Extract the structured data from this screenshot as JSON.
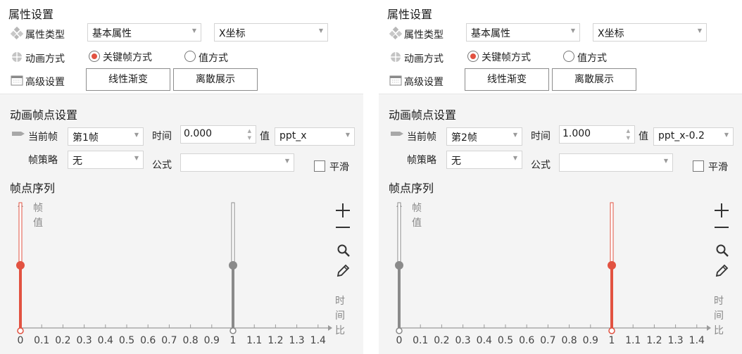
{
  "colors": {
    "accent": "#e25241",
    "gray_handle": "#8a8a8a",
    "axis": "#9a9a9a"
  },
  "panels": [
    {
      "property_settings": {
        "title": "属性设置",
        "property_type_label": "属性类型",
        "property_type_value": "基本属性",
        "property_sub_value": "X坐标",
        "animation_mode_label": "动画方式",
        "radio_keyframe": "关键帧方式",
        "radio_value": "值方式",
        "radio_selected": "keyframe",
        "advanced_label": "高级设置",
        "btn_linear": "线性渐变",
        "btn_discrete": "离散展示"
      },
      "frame_settings": {
        "title": "动画帧点设置",
        "current_frame_label": "当前帧",
        "current_frame_value": "第1帧",
        "time_label": "时间",
        "time_value": "0.000",
        "value_label": "值",
        "value_value": "ppt_x",
        "strategy_label": "帧策略",
        "strategy_value": "无",
        "formula_label": "公式",
        "formula_value": "",
        "smooth_label": "平滑"
      },
      "sequence": {
        "title": "帧点序列",
        "y_axis_label_1": "帧",
        "y_axis_label_2": "值",
        "x_axis_label_1": "时",
        "x_axis_label_2": "间",
        "x_axis_label_3": "比",
        "x_ticks": [
          "0",
          "0.1",
          "0.2",
          "0.3",
          "0.4",
          "0.5",
          "0.6",
          "0.7",
          "0.8",
          "0.9",
          "1",
          "1.1",
          "1.2",
          "1.3",
          "1.4"
        ],
        "x_range": [
          0,
          1.4
        ],
        "keyframes": [
          {
            "t": 0,
            "level": 0.5,
            "selected": true
          },
          {
            "t": 1,
            "level": 0.5,
            "selected": false
          }
        ]
      }
    },
    {
      "property_settings": {
        "title": "属性设置",
        "property_type_label": "属性类型",
        "property_type_value": "基本属性",
        "property_sub_value": "X坐标",
        "animation_mode_label": "动画方式",
        "radio_keyframe": "关键帧方式",
        "radio_value": "值方式",
        "radio_selected": "keyframe",
        "advanced_label": "高级设置",
        "btn_linear": "线性渐变",
        "btn_discrete": "离散展示"
      },
      "frame_settings": {
        "title": "动画帧点设置",
        "current_frame_label": "当前帧",
        "current_frame_value": "第2帧",
        "time_label": "时间",
        "time_value": "1.000",
        "value_label": "值",
        "value_value": "ppt_x-0.2",
        "strategy_label": "帧策略",
        "strategy_value": "无",
        "formula_label": "公式",
        "formula_value": "",
        "smooth_label": "平滑"
      },
      "sequence": {
        "title": "帧点序列",
        "y_axis_label_1": "帧",
        "y_axis_label_2": "值",
        "x_axis_label_1": "时",
        "x_axis_label_2": "间",
        "x_axis_label_3": "比",
        "x_ticks": [
          "0",
          "0.1",
          "0.2",
          "0.3",
          "0.4",
          "0.5",
          "0.6",
          "0.7",
          "0.8",
          "0.9",
          "1",
          "1.1",
          "1.2",
          "1.3",
          "1.4"
        ],
        "x_range": [
          0,
          1.4
        ],
        "keyframes": [
          {
            "t": 0,
            "level": 0.5,
            "selected": false
          },
          {
            "t": 1,
            "level": 0.5,
            "selected": true
          }
        ]
      }
    }
  ]
}
